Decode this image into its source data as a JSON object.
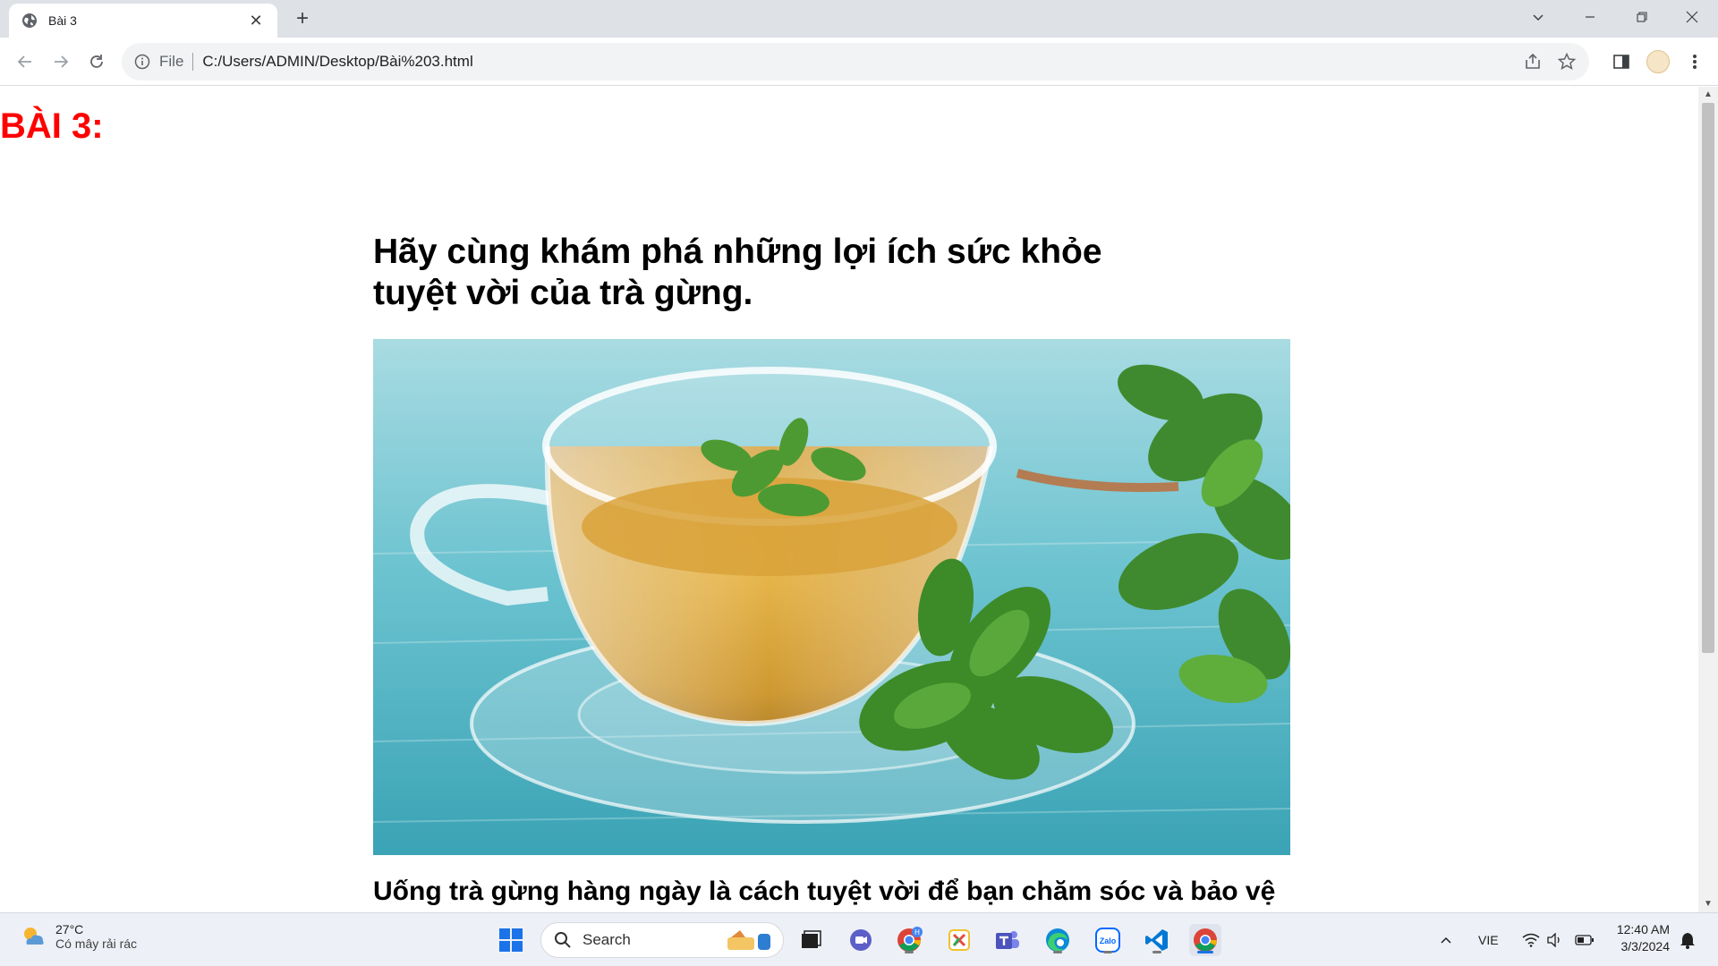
{
  "browser": {
    "tab_title": "Bài 3",
    "address_scheme": "File",
    "address_url": "C:/Users/ADMIN/Desktop/Bài%203.html"
  },
  "page": {
    "label": "BÀI 3:",
    "headline_line1": "Hãy cùng khám phá những lợi ích sức khỏe",
    "headline_line2": "tuyệt vời của trà gừng.",
    "paragraph": "Uống trà gừng hàng ngày là cách tuyệt vời để bạn chăm sóc và bảo vệ"
  },
  "taskbar": {
    "weather_temp": "27°C",
    "weather_desc": "Có mây rải rác",
    "search_label": "Search",
    "language": "VIE",
    "time": "12:40 AM",
    "date": "3/3/2024"
  },
  "colors": {
    "label_red": "#ff0000",
    "tab_strip": "#dee1e6",
    "omnibox_bg": "#f1f3f4"
  }
}
